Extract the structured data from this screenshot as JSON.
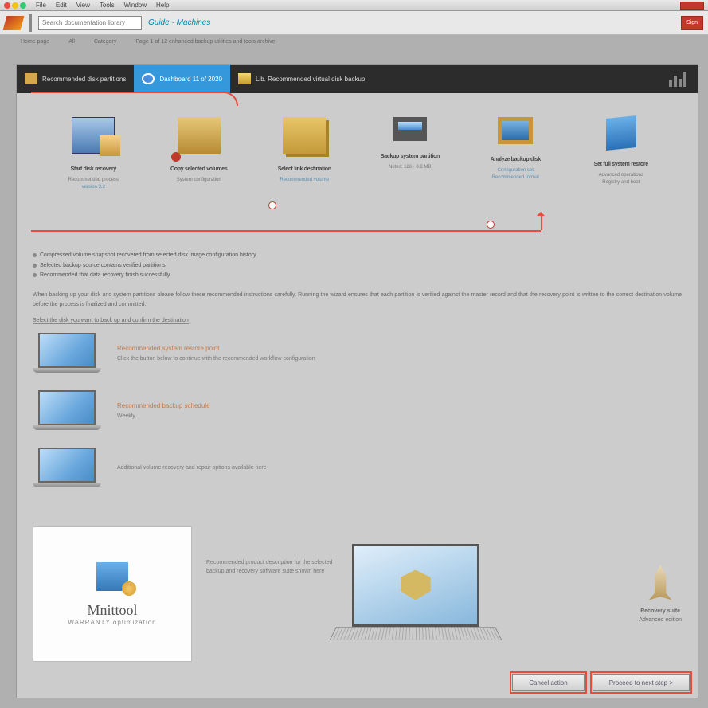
{
  "menubar": {
    "items": [
      "File",
      "Edit",
      "View",
      "Tools",
      "Window",
      "Help"
    ]
  },
  "toolbar": {
    "search_placeholder": "Search documentation library",
    "title": "Guide · Machines",
    "right": "Sign"
  },
  "crumbs": [
    "Home page",
    "All",
    "Category",
    "Page 1 of 12 enhanced backup utilities and tools archive"
  ],
  "tabs": [
    {
      "label": "Recommended disk partitions"
    },
    {
      "label": "Dashboard 11 of 2020"
    },
    {
      "label": "Lib. Recommended virtual disk backup"
    }
  ],
  "steps": [
    {
      "title": "Start disk recovery",
      "sub1": "Recommended process",
      "sub2": "version 3.2"
    },
    {
      "title": "Copy selected volumes",
      "sub1": "System configuration"
    },
    {
      "title": "Select link destination",
      "sub1": "Recommended volume",
      "sub2": ""
    },
    {
      "title": "Backup system partition",
      "sub1": "Notes: 126 · 0.8 MB"
    },
    {
      "title": "Analyze backup disk",
      "sub1": "Configuration set",
      "sub2": "Recommended format"
    },
    {
      "title": "Set full system restore",
      "sub1": "Advanced operations",
      "sub2": "Registry and boot"
    }
  ],
  "bullets": [
    "Compressed volume snapshot recovered from selected disk image configuration history",
    "Selected backup source contains verified partitions",
    "Recommended that data recovery finish successfully"
  ],
  "para1": "When backing up your disk and system partitions please follow these recommended instructions carefully. Running the wizard ensures that each partition is verified against the master record and that the recovery point is written to the correct destination volume before the process is finalized and committed.",
  "para2": "Select the disk you want to back up and confirm the destination",
  "laps": [
    {
      "t": "Recommended system restore point",
      "d": "Click the button below to continue with the recommended workflow configuration"
    },
    {
      "t": "Recommended backup schedule",
      "d": "Weekly"
    },
    {
      "t": "",
      "d": "Additional volume recovery and repair options available here"
    }
  ],
  "product": {
    "name": "Mnittool",
    "tag": "WARRANTY optimization"
  },
  "mid": "Recommended product description for the selected backup and recovery software suite shown here",
  "side": {
    "t": "Recovery suite",
    "d": "Advanced edition"
  },
  "footer": {
    "cancel": "Cancel action",
    "next": "Proceed to next step >"
  }
}
